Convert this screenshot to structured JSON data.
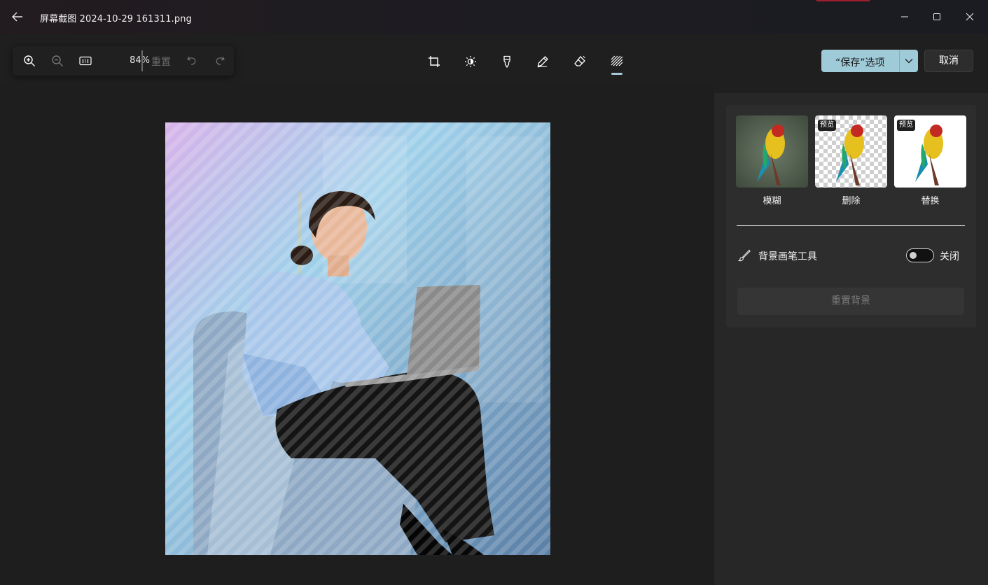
{
  "titlebar": {
    "title": "屏幕截图 2024-10-29 161311.png"
  },
  "zoombar": {
    "zoom_value": "84%",
    "reset_label": "重置"
  },
  "actions": {
    "save_label": "“保存”选项",
    "cancel_label": "取消"
  },
  "background_panel": {
    "options": [
      {
        "label": "模糊",
        "badge": ""
      },
      {
        "label": "删除",
        "badge": "预览"
      },
      {
        "label": "替换",
        "badge": "预览"
      }
    ],
    "brush_tool_label": "背景画笔工具",
    "toggle_state_label": "关闭",
    "reset_background_label": "重置背景"
  },
  "colors": {
    "accent": "#9fcbd8",
    "panel": "#272727",
    "card": "#2d2d2d"
  },
  "icons": [
    "back-arrow-icon",
    "minimize-icon",
    "maximize-icon",
    "close-icon",
    "zoom-in-icon",
    "zoom-out-icon",
    "actual-size-icon",
    "undo-icon",
    "redo-icon",
    "crop-icon",
    "brightness-icon",
    "marker-icon",
    "pen-icon",
    "erase-icon",
    "background-icon",
    "chevron-down-icon",
    "brush-icon"
  ]
}
